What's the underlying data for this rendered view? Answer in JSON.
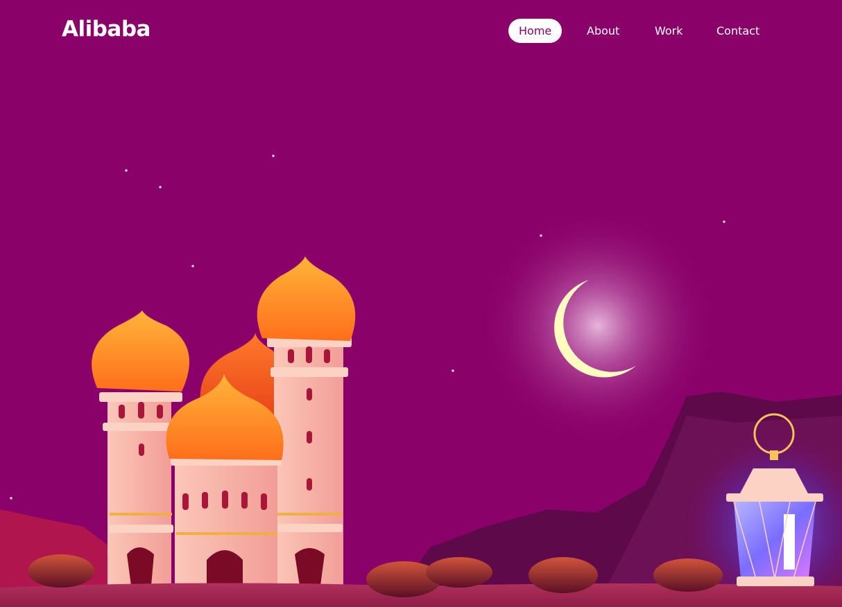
{
  "brand": {
    "logo_text": "Alibaba"
  },
  "nav": {
    "items": [
      {
        "label": "Home",
        "active": true
      },
      {
        "label": "About",
        "active": false
      },
      {
        "label": "Work",
        "active": false
      },
      {
        "label": "Contact",
        "active": false
      }
    ]
  },
  "colors": {
    "background": "#8a016a",
    "nav_active_bg": "#ffffff",
    "nav_active_text": "#8a016a",
    "dome_orange": "#ff8c1a",
    "tower_pink": "#f6b2a8",
    "moon": "#fffcc0",
    "lantern_glow": "#7b6cff"
  },
  "illustration": {
    "icons": [
      "crescent-moon",
      "mosque",
      "lantern",
      "stars",
      "dates",
      "mountains"
    ]
  }
}
